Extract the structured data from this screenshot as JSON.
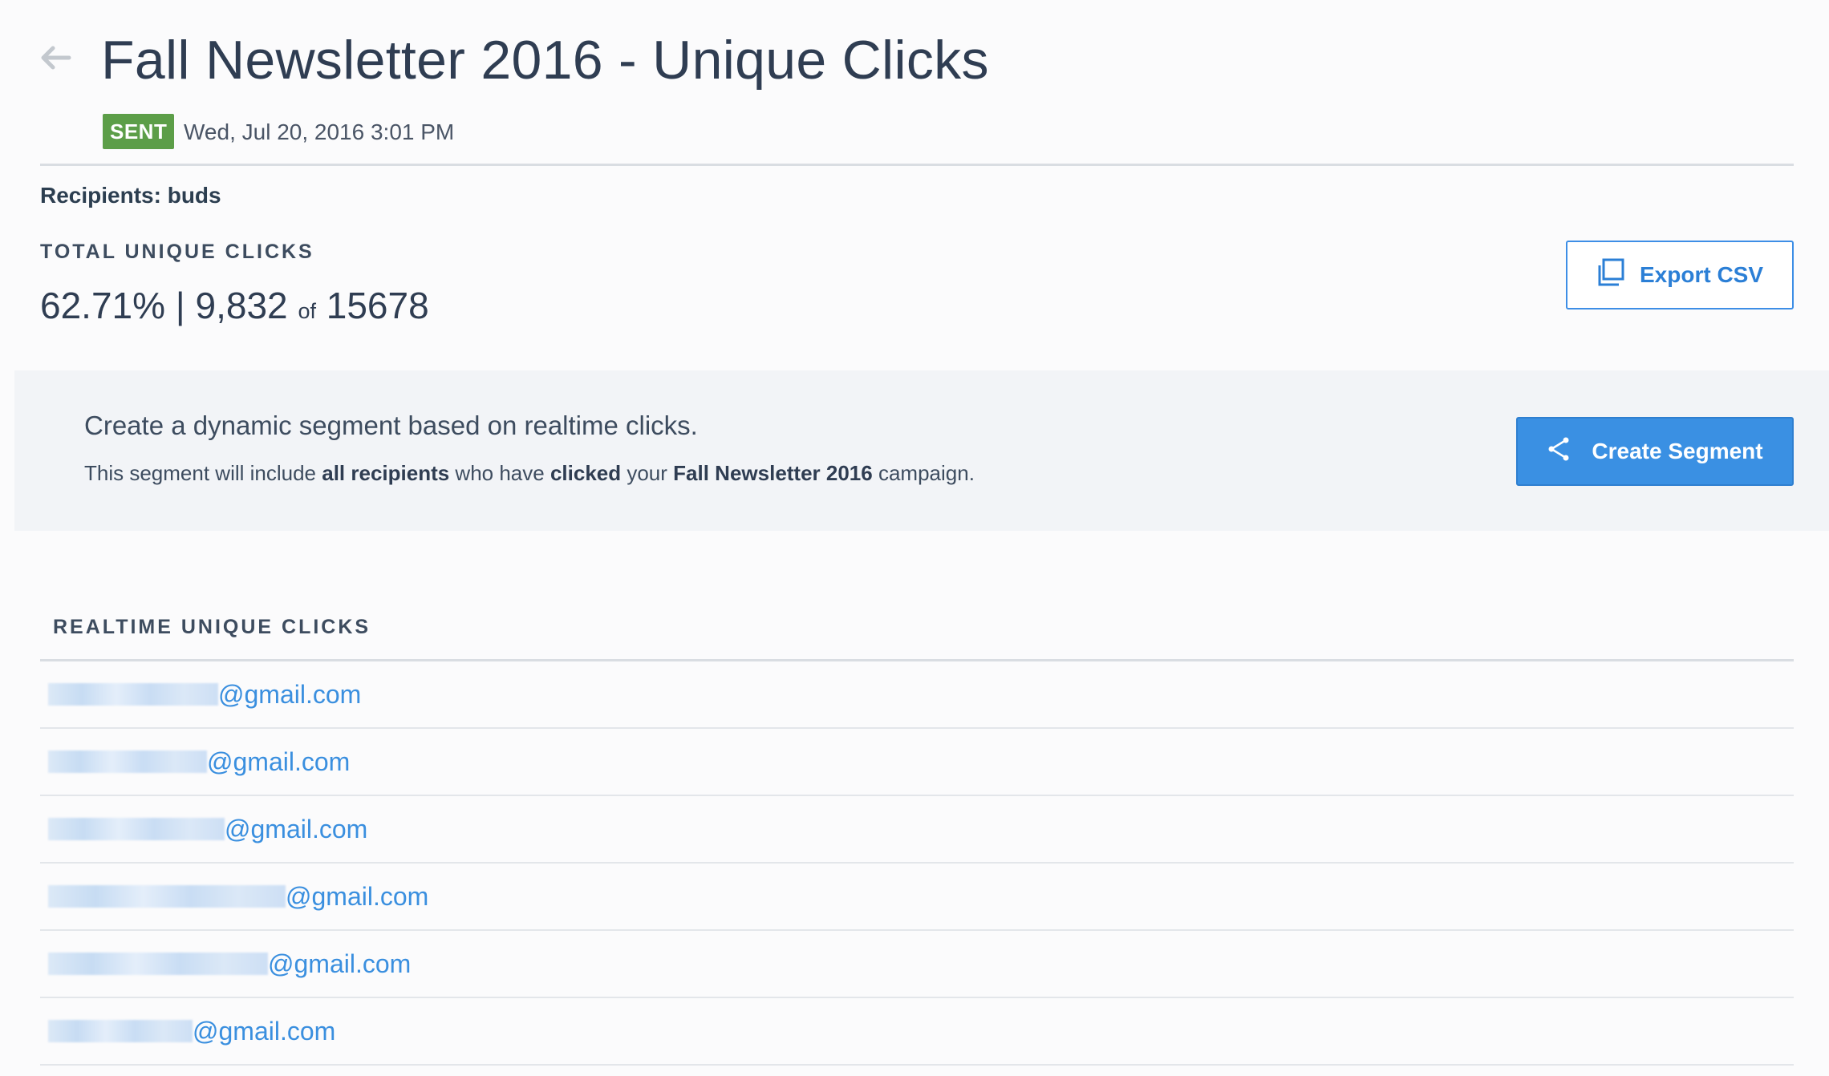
{
  "header": {
    "title": "Fall Newsletter 2016 - Unique Clicks",
    "status_badge": "SENT",
    "sent_date": "Wed, Jul 20, 2016 3:01 PM"
  },
  "recipients": {
    "label": "Recipients:",
    "value": "buds"
  },
  "stats": {
    "label": "TOTAL UNIQUE CLICKS",
    "percent": "62.71%",
    "separator": "|",
    "count": "9,832",
    "of_word": "of",
    "total": "15678"
  },
  "export_button": {
    "label": "Export CSV",
    "icon": "copy-icon"
  },
  "segment": {
    "heading": "Create a dynamic segment based on realtime clicks.",
    "desc_1": "This segment will include ",
    "desc_2": "all recipients",
    "desc_3": " who have ",
    "desc_4": "clicked",
    "desc_5": " your ",
    "desc_6": "Fall Newsletter 2016",
    "desc_7": " campaign.",
    "button_label": "Create Segment",
    "button_icon": "share-icon"
  },
  "list": {
    "label": "REALTIME UNIQUE CLICKS",
    "rows": [
      {
        "domain": "@gmail.com"
      },
      {
        "domain": "@gmail.com"
      },
      {
        "domain": "@gmail.com"
      },
      {
        "domain": "@gmail.com"
      },
      {
        "domain": "@gmail.com"
      },
      {
        "domain": "@gmail.com"
      }
    ]
  },
  "colors": {
    "accent": "#3a90e3",
    "sent_badge": "#5c9e48",
    "link": "#3a8fdf"
  }
}
